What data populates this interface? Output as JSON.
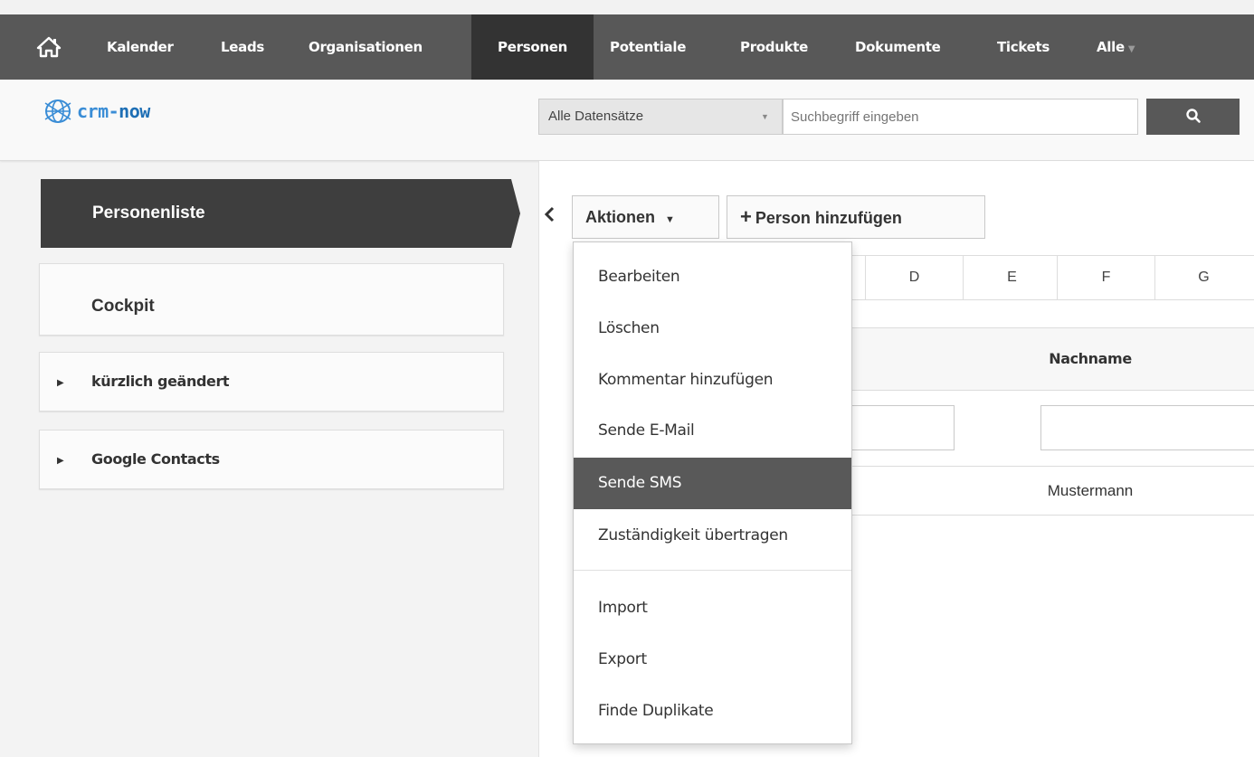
{
  "nav": {
    "items": [
      "Kalender",
      "Leads",
      "Organisationen",
      "Personen",
      "Potentiale",
      "Produkte",
      "Dokumente",
      "Tickets",
      "Alle"
    ],
    "active": "Personen"
  },
  "logo": {
    "text_a": "crm-",
    "text_b": "now"
  },
  "search": {
    "scope": "Alle Datensätze",
    "placeholder": "Suchbegriff eingeben"
  },
  "sidebar": {
    "active": "Personenliste",
    "cockpit": "Cockpit",
    "sections": [
      "kürzlich geändert",
      "Google Contacts"
    ]
  },
  "toolbar": {
    "actions_label": "Aktionen",
    "add_label": "Person hinzufügen"
  },
  "alphabet": [
    "D",
    "E",
    "F",
    "G"
  ],
  "table": {
    "column": "Nachname",
    "rows": [
      {
        "nachname": "Mustermann"
      }
    ]
  },
  "dropdown": {
    "items": [
      "Bearbeiten",
      "Löschen",
      "Kommentar hinzufügen",
      "Sende E-Mail",
      "Sende SMS",
      "Zuständigkeit übertragen",
      "Import",
      "Export",
      "Finde Duplikate"
    ],
    "highlighted": "Sende SMS"
  },
  "colors": {
    "nav_bg": "#585858",
    "nav_active": "#333333",
    "accent": "#3a8dd6",
    "menu_highlight": "#595959"
  }
}
